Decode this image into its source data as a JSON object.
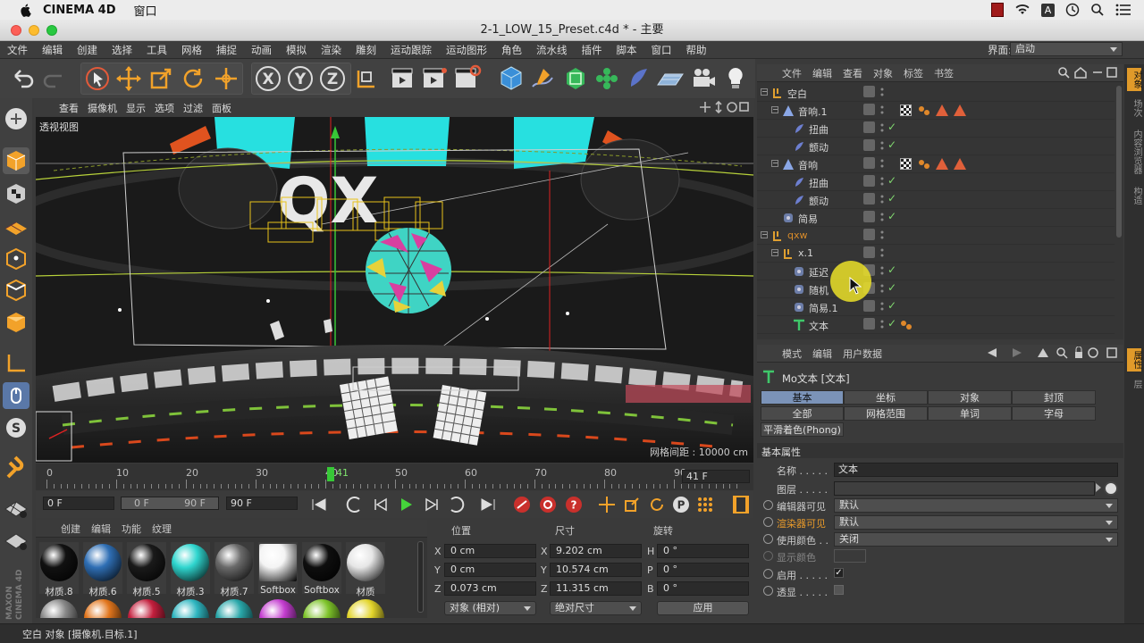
{
  "mac": {
    "app": "CINEMA 4D",
    "menu": "窗口"
  },
  "window": {
    "title": "2-1_LOW_15_Preset.c4d * - 主要"
  },
  "menu": [
    "文件",
    "编辑",
    "创建",
    "选择",
    "工具",
    "网格",
    "捕捉",
    "动画",
    "模拟",
    "渲染",
    "雕刻",
    "运动跟踪",
    "运动图形",
    "角色",
    "流水线",
    "插件",
    "脚本",
    "窗口",
    "帮助"
  ],
  "layout": {
    "label": "界面:",
    "value": "启动"
  },
  "viewport": {
    "menu": [
      "查看",
      "摄像机",
      "显示",
      "选项",
      "过滤",
      "面板"
    ],
    "label": "透视视图",
    "grid": "网格间距 : 10000 cm"
  },
  "timeline": {
    "ticks": [
      "0",
      "10",
      "20",
      "30",
      "40",
      "50",
      "60",
      "70",
      "80",
      "90"
    ],
    "current": "41",
    "frame_field": "41 F"
  },
  "playback": {
    "start": "0 F",
    "range_start": "0 F",
    "range_end": "90 F",
    "end": "90 F"
  },
  "objects": {
    "menu": [
      "文件",
      "编辑",
      "查看",
      "对象",
      "标签",
      "书签"
    ],
    "rows": [
      {
        "name": "空白",
        "indent": 0,
        "icon": "null",
        "checked": false,
        "tags": []
      },
      {
        "name": "音响.1",
        "indent": 1,
        "icon": "pose",
        "checked": false,
        "tags": [
          "checker",
          "dots",
          "tri",
          "tri"
        ]
      },
      {
        "name": "扭曲",
        "indent": 2,
        "icon": "deform",
        "checked": true,
        "tags": []
      },
      {
        "name": "颤动",
        "indent": 2,
        "icon": "deform",
        "checked": true,
        "tags": []
      },
      {
        "name": "音响",
        "indent": 1,
        "icon": "pose",
        "checked": false,
        "tags": [
          "checker",
          "dots",
          "tri",
          "tri"
        ]
      },
      {
        "name": "扭曲",
        "indent": 2,
        "icon": "deform",
        "checked": true,
        "tags": []
      },
      {
        "name": "颤动",
        "indent": 2,
        "icon": "deform",
        "checked": true,
        "tags": []
      },
      {
        "name": "简易",
        "indent": 1,
        "icon": "effector",
        "checked": true,
        "tags": []
      },
      {
        "name": "qxw",
        "indent": 0,
        "icon": "null",
        "checked": false,
        "tags": [],
        "color": "#d88b2a"
      },
      {
        "name": "x.1",
        "indent": 1,
        "icon": "null",
        "checked": false,
        "tags": []
      },
      {
        "name": "延迟",
        "indent": 2,
        "icon": "effector",
        "checked": true,
        "tags": []
      },
      {
        "name": "随机",
        "indent": 2,
        "icon": "effector",
        "checked": true,
        "tags": []
      },
      {
        "name": "简易.1",
        "indent": 2,
        "icon": "effector",
        "checked": true,
        "tags": []
      },
      {
        "name": "文本",
        "indent": 2,
        "icon": "text",
        "checked": true,
        "tags": [
          "dots"
        ]
      }
    ]
  },
  "attributes": {
    "menu": [
      "模式",
      "编辑",
      "用户数据"
    ],
    "object_title": "Mo文本 [文本]",
    "tabs_row1": [
      "基本",
      "坐标",
      "对象",
      "封顶"
    ],
    "tabs_row2": [
      "全部",
      "网格范围",
      "单词",
      "字母"
    ],
    "tab_phong": "平滑着色(Phong)",
    "section": "基本属性",
    "name_label": "名称 . . . . .",
    "name_value": "文本",
    "layer_label": "图层 . . . . .",
    "editor_visible_label": "编辑器可见",
    "editor_visible_value": "默认",
    "render_visible_label": "渲染器可见",
    "render_visible_value": "默认",
    "use_color_label": "使用颜色 . .",
    "use_color_value": "关闭",
    "display_color_label": "显示颜色",
    "enable_label": "启用 . . . . .",
    "xray_label": "透显 . . . . ."
  },
  "materials": {
    "menu": [
      "创建",
      "编辑",
      "功能",
      "纹理"
    ],
    "items": [
      {
        "name": "材质.8",
        "color": "#111111"
      },
      {
        "name": "材质.6",
        "color": "#2f6fb5"
      },
      {
        "name": "材质.5",
        "color": "#1a1a1a"
      },
      {
        "name": "材质.3",
        "color": "#2fd6cf"
      },
      {
        "name": "材质.7",
        "color": "#6a6a6a"
      },
      {
        "name": "Softbox",
        "color": "#f4f4f4"
      },
      {
        "name": "Softbox",
        "color": "#0e0e0e"
      },
      {
        "name": "材质",
        "color": "#e6e6e6"
      }
    ],
    "row2_colors": [
      "#888888",
      "#e2761d",
      "#c31f3d",
      "#2fb6c0",
      "#29a7a9",
      "#c43ed0",
      "#7ec42a",
      "#e3d52b"
    ]
  },
  "coords": {
    "headers": [
      "位置",
      "尺寸",
      "旋转"
    ],
    "pos": [
      "0 cm",
      "0 cm",
      "0.073 cm"
    ],
    "size": [
      "9.202 cm",
      "10.574 cm",
      "11.315 cm"
    ],
    "rot": [
      "0 °",
      "0 °",
      "0 °"
    ],
    "axis_pos": [
      "X",
      "Y",
      "Z"
    ],
    "axis_size": [
      "X",
      "Y",
      "Z"
    ],
    "axis_rot": [
      "H",
      "P",
      "B"
    ],
    "mode": "对象 (相对)",
    "size_mode": "绝对尺寸",
    "apply": "应用"
  },
  "status": "空白 对象 [摄像机.目标.1]",
  "side_tabs": [
    "对象",
    "场次",
    "内容浏览器",
    "构造"
  ],
  "side_tabs2": [
    "属性",
    "层"
  ],
  "brand": "MAXON CINEMA 4D"
}
